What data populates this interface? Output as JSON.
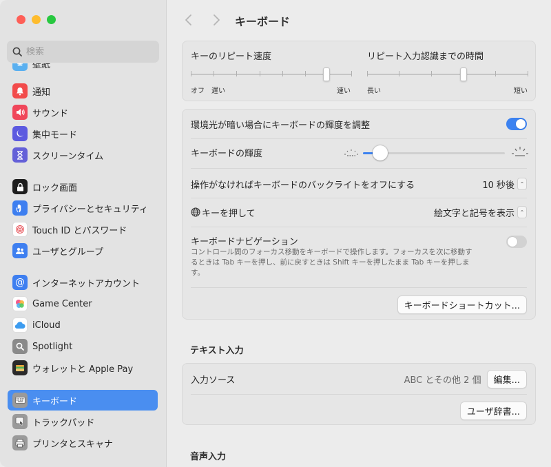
{
  "window": {
    "title": "キーボード"
  },
  "search": {
    "placeholder": "検索"
  },
  "sidebar": {
    "partial_top": "壁紙",
    "items": [
      {
        "label": "通知",
        "icon": "bell-icon",
        "color": "#f24b4b"
      },
      {
        "label": "サウンド",
        "icon": "speaker-icon",
        "color": "#f0465a"
      },
      {
        "label": "集中モード",
        "icon": "moon-icon",
        "color": "#5c5ae0"
      },
      {
        "label": "スクリーンタイム",
        "icon": "hourglass-icon",
        "color": "#6460d8"
      },
      {
        "label": "ロック画面",
        "icon": "lock-icon",
        "color": "#1e1e1e"
      },
      {
        "label": "プライバシーとセキュリティ",
        "icon": "hand-icon",
        "color": "#3e7ff0"
      },
      {
        "label": "Touch ID とパスワード",
        "icon": "fingerprint-icon",
        "color": "#ffffff"
      },
      {
        "label": "ユーザとグループ",
        "icon": "users-icon",
        "color": "#3e7ff0"
      },
      {
        "label": "インターネットアカウント",
        "icon": "at-icon",
        "color": "#3e7ff0"
      },
      {
        "label": "Game Center",
        "icon": "gamecenter-icon",
        "color": "#ffffff"
      },
      {
        "label": "iCloud",
        "icon": "cloud-icon",
        "color": "#ffffff"
      },
      {
        "label": "Spotlight",
        "icon": "magnifier-icon",
        "color": "#8a8a8a"
      },
      {
        "label": "ウォレットと Apple Pay",
        "icon": "wallet-icon",
        "color": "#2a2a2a"
      },
      {
        "label": "キーボード",
        "icon": "keyboard-icon",
        "color": "#9a9a9a",
        "selected": true
      },
      {
        "label": "トラックパッド",
        "icon": "trackpad-icon",
        "color": "#9a9a9a"
      },
      {
        "label": "プリンタとスキャナ",
        "icon": "printer-icon",
        "color": "#9a9a9a"
      }
    ]
  },
  "repeat": {
    "left_title": "キーのリピート速度",
    "left_min": "オフ",
    "left_slow": "遅い",
    "left_fast": "速い",
    "left_value": 0.84,
    "right_title": "リピート入力認識までの時間",
    "right_long": "長い",
    "right_short": "短い",
    "right_value": 0.6
  },
  "settings": {
    "auto_brightness": "環境光が暗い場合にキーボードの輝度を調整",
    "brightness_label": "キーボードの輝度",
    "brightness_value": 0.07,
    "backlight_off": "操作がなければキーボードのバックライトをオフにする",
    "backlight_value": "10 秒後",
    "globe_key": "キーを押して",
    "globe_value": "絵文字と記号を表示",
    "nav_title": "キーボードナビゲーション",
    "nav_desc": "コントロール間のフォーカス移動をキーボードで操作します。フォーカスを次に移動するときは Tab キーを押し、前に戻すときは Shift キーを押したまま Tab キーを押します。",
    "shortcuts_btn": "キーボードショートカット..."
  },
  "text_input": {
    "section": "テキスト入力",
    "sources_label": "入力ソース",
    "sources_value": "ABC とその他 2 個",
    "edit_btn": "編集...",
    "dict_btn": "ユーザ辞書..."
  },
  "dictation": {
    "section": "音声入力"
  }
}
